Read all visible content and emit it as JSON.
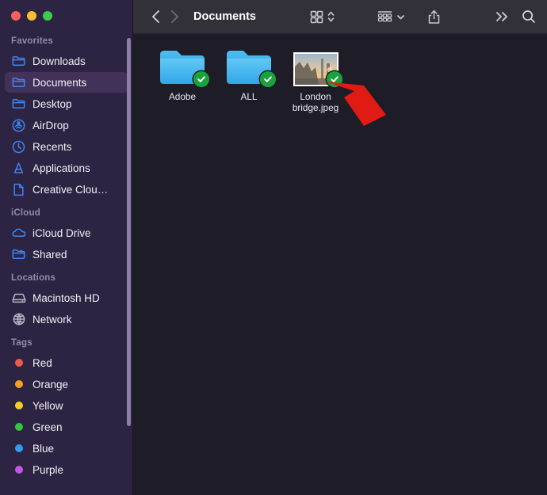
{
  "window": {
    "traffic_lights": [
      {
        "name": "close",
        "color": "#f8605a"
      },
      {
        "name": "minimize",
        "color": "#f9bd30"
      },
      {
        "name": "zoom",
        "color": "#3ecb4f"
      }
    ],
    "sidebar_bg": "#2d2342",
    "content_bg": "#1e1c26",
    "toolbar_bg": "#32313a"
  },
  "toolbar": {
    "back_label": "‹",
    "forward_label": "›",
    "title": "Documents",
    "view_icon": "grid-view-icon",
    "view_chevron": "chevron-up-down-icon",
    "group_icon": "group-by-icon",
    "group_chevron": "chevron-down-icon",
    "share_icon": "share-icon",
    "more_icon": "double-chevron-right-icon",
    "search_icon": "search-icon"
  },
  "sidebar": {
    "sections": [
      {
        "title": "Favorites",
        "items": [
          {
            "label": "Downloads",
            "icon": "folder-icon",
            "selected": false
          },
          {
            "label": "Documents",
            "icon": "folder-icon",
            "selected": true
          },
          {
            "label": "Desktop",
            "icon": "folder-icon",
            "selected": false
          },
          {
            "label": "AirDrop",
            "icon": "airdrop-icon",
            "selected": false
          },
          {
            "label": "Recents",
            "icon": "clock-icon",
            "selected": false
          },
          {
            "label": "Applications",
            "icon": "applications-icon",
            "selected": false
          },
          {
            "label": "Creative Clou…",
            "icon": "document-icon",
            "selected": false
          }
        ]
      },
      {
        "title": "iCloud",
        "items": [
          {
            "label": "iCloud Drive",
            "icon": "cloud-icon",
            "selected": false
          },
          {
            "label": "Shared",
            "icon": "shared-folder-icon",
            "selected": false
          }
        ]
      },
      {
        "title": "Locations",
        "items": [
          {
            "label": "Macintosh HD",
            "icon": "harddisk-icon",
            "selected": false
          },
          {
            "label": "Network",
            "icon": "globe-icon",
            "selected": false
          }
        ]
      },
      {
        "title": "Tags",
        "items": [
          {
            "label": "Red",
            "icon": "tag-dot-icon",
            "color": "#f0574f"
          },
          {
            "label": "Orange",
            "icon": "tag-dot-icon",
            "color": "#f2a01e"
          },
          {
            "label": "Yellow",
            "icon": "tag-dot-icon",
            "color": "#f2d023"
          },
          {
            "label": "Green",
            "icon": "tag-dot-icon",
            "color": "#36c43f"
          },
          {
            "label": "Blue",
            "icon": "tag-dot-icon",
            "color": "#2e9cf0"
          },
          {
            "label": "Purple",
            "icon": "tag-dot-icon",
            "color": "#c655e8"
          }
        ]
      }
    ]
  },
  "files": [
    {
      "name": "Adobe",
      "kind": "folder",
      "badge": "checkmark-badge-icon"
    },
    {
      "name": "ALL",
      "kind": "folder",
      "badge": "checkmark-badge-icon"
    },
    {
      "name": "London bridge.jpeg",
      "kind": "image",
      "badge": "checkmark-badge-icon"
    }
  ],
  "annotation": {
    "arrow_color": "#e01b14",
    "points_at": "checkmark-badge-icon"
  }
}
